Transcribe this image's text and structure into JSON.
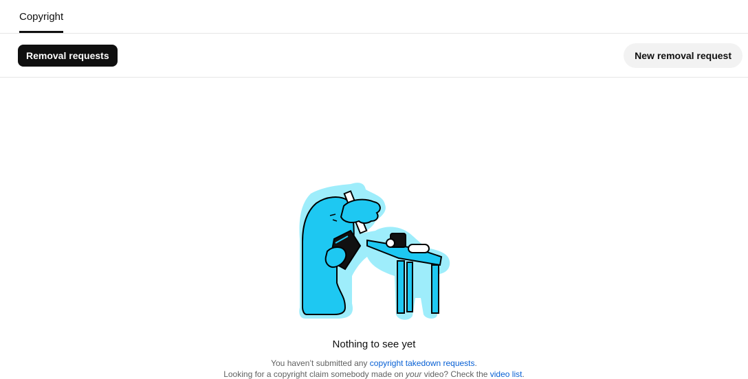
{
  "tabs": [
    {
      "label": "Copyright",
      "active": true
    }
  ],
  "toolbar": {
    "filter_chip_label": "Removal requests",
    "new_request_label": "New removal request"
  },
  "empty_state": {
    "title": "Nothing to see yet",
    "line1_prefix": "You haven’t submitted any ",
    "line1_link": "copyright takedown requests",
    "line1_suffix": ".",
    "line2_prefix": "Looking for a copyright claim somebody made on ",
    "line2_emphasis": "your",
    "line2_middle": " video? Check the ",
    "line2_link": "video list",
    "line2_suffix": "."
  },
  "colors": {
    "accent_dark": "#0f0f0f",
    "link": "#065fd4",
    "illustration_cyan": "#1ec8f2",
    "illustration_halo": "#9eedfb"
  },
  "icons": {
    "illustration": "person-holding-book-and-stick-at-table-illustration"
  }
}
